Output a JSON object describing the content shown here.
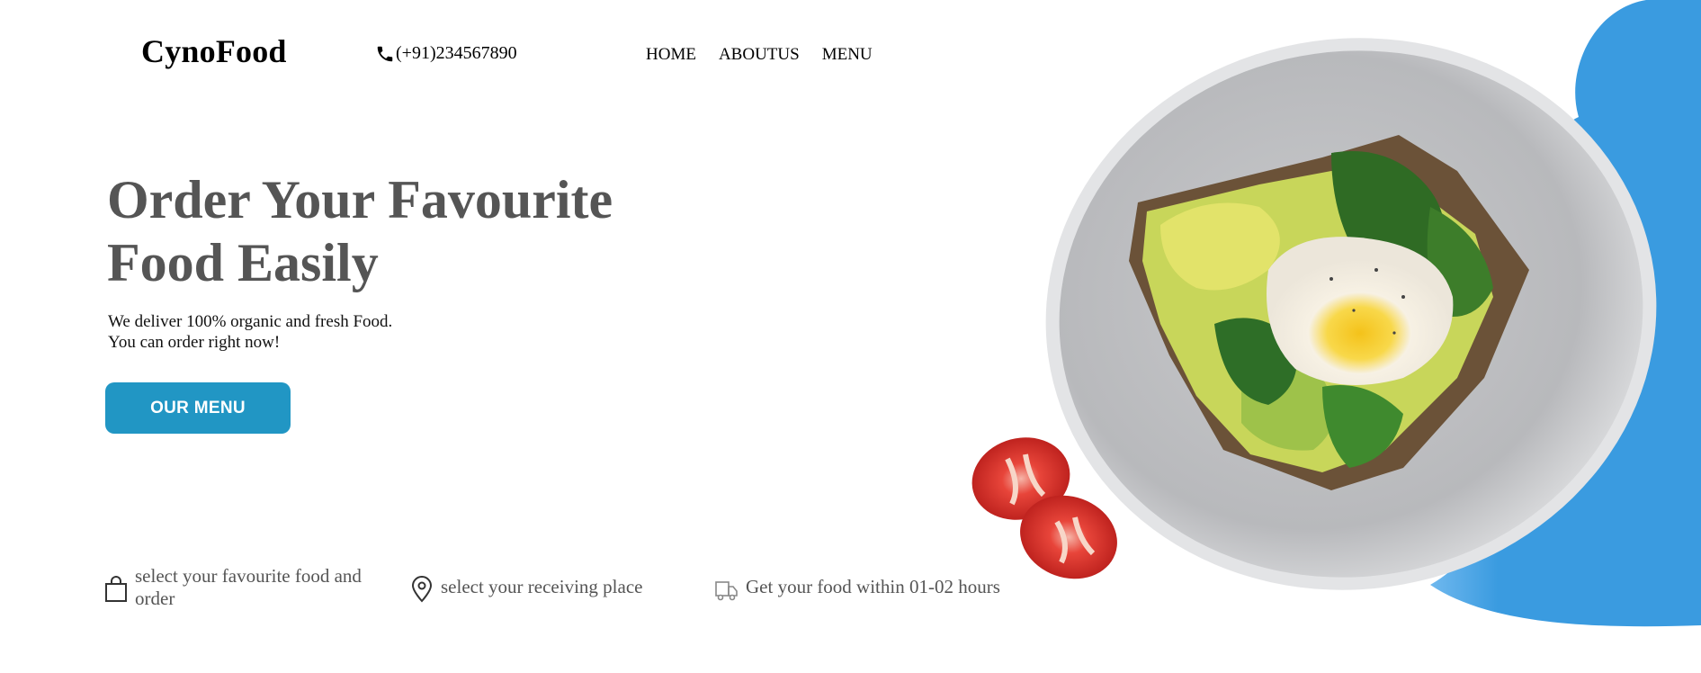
{
  "header": {
    "logo": "CynoFood",
    "phone": "(+91)234567890",
    "nav": [
      "HOME",
      "ABOUTUS",
      "MENU"
    ]
  },
  "hero": {
    "title_line1": "Order Your Favourite",
    "title_line2": "Food Easily",
    "text_line1": "We deliver 100% organic and fresh Food.",
    "text_line2": "You can order right now!",
    "button_label": "OUR MENU"
  },
  "features": [
    {
      "text": "select your favourite food and order",
      "icon": "shopping-bag-icon"
    },
    {
      "text": "select your receiving place",
      "icon": "location-pin-icon"
    },
    {
      "text": "Get your food within 01-02 hours",
      "icon": "delivery-truck-icon"
    }
  ],
  "colors": {
    "accent": "#2196c4",
    "blob": "#3a9be0",
    "heading": "#555555"
  }
}
